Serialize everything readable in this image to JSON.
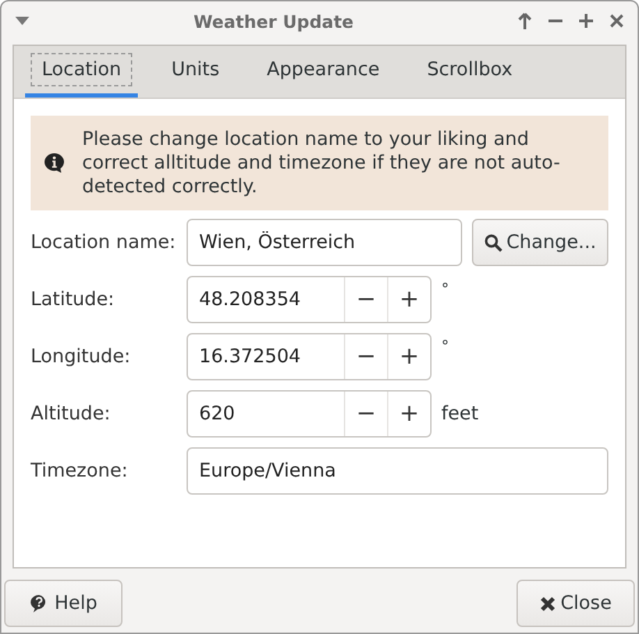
{
  "window": {
    "title": "Weather Update"
  },
  "tabs": [
    {
      "label": "Location",
      "selected": true
    },
    {
      "label": "Units",
      "selected": false
    },
    {
      "label": "Appearance",
      "selected": false
    },
    {
      "label": "Scrollbox",
      "selected": false
    }
  ],
  "info": {
    "text": "Please change location name to your liking and correct alltitude and timezone if they are not auto-detected correctly."
  },
  "rows": [
    {
      "kind": "text-button",
      "label": "Location name:",
      "value": "Wien, Österreich",
      "button": "Change..."
    },
    {
      "kind": "spin",
      "label": "Latitude:",
      "value": "48.208354",
      "minus": "−",
      "plus": "+",
      "unit": "°"
    },
    {
      "kind": "spin",
      "label": "Longitude:",
      "value": "16.372504",
      "minus": "−",
      "plus": "+",
      "unit": "°"
    },
    {
      "kind": "spin",
      "label": "Altitude:",
      "value": "620",
      "minus": "−",
      "plus": "+",
      "unit": "feet"
    },
    {
      "kind": "text",
      "label": "Timezone:",
      "value": "Europe/Vienna"
    }
  ],
  "buttons": [
    {
      "kind": "help",
      "label": "Help"
    },
    {
      "kind": "close",
      "label": "Close"
    }
  ]
}
